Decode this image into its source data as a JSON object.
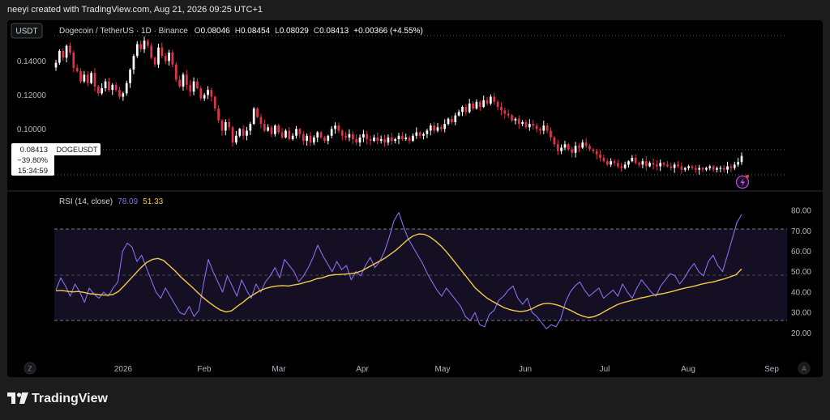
{
  "header": {
    "caption": "neeyi created with TradingView.com, Aug 21, 2026 09:25 UTC+1"
  },
  "main_pane": {
    "currency_button": "USDT",
    "symbol_desc": "Dogecoin / TetherUS · 1D · Binance",
    "ohlc": {
      "o_label": "O",
      "o_value": "0.08046",
      "h_label": "H",
      "h_value": "0.08454",
      "l_label": "L",
      "l_value": "0.08029",
      "c_label": "C",
      "c_value": "0.08413",
      "change": "+0.00366 (+4.55%)"
    },
    "price_tag": {
      "price": "0.08413",
      "change_pct": "−39.80%",
      "countdown": "15:34:59",
      "symbol": "DOGEUSDT"
    },
    "up_color": "#ffffff",
    "down_color": "#e0344c"
  },
  "rsi_pane": {
    "label": "RSI (14, close)",
    "rsi_value": "78.09",
    "ma_value": "51.33",
    "rsi_color": "#8e6cf0",
    "ma_color": "#f2c94c"
  },
  "bottom_buttons": {
    "left": "Z",
    "right": "A"
  },
  "footer": {
    "brand": "TradingView"
  },
  "chart_data": [
    {
      "type": "candlestick",
      "title": "Dogecoin / TetherUS · 1D · Binance",
      "x_ticks": [
        "2026",
        "Feb",
        "Mar",
        "Apr",
        "May",
        "Jun",
        "Jul",
        "Aug",
        "Sep"
      ],
      "y_ticks": [
        "0.14000",
        "0.12000",
        "0.10000"
      ],
      "ylim": [
        0.073,
        0.155
      ],
      "last_price": 0.08413,
      "series_closes": [
        0.139,
        0.146,
        0.142,
        0.149,
        0.145,
        0.136,
        0.134,
        0.128,
        0.132,
        0.127,
        0.133,
        0.125,
        0.121,
        0.124,
        0.128,
        0.123,
        0.126,
        0.123,
        0.119,
        0.121,
        0.127,
        0.135,
        0.143,
        0.15,
        0.147,
        0.152,
        0.149,
        0.142,
        0.138,
        0.148,
        0.143,
        0.14,
        0.145,
        0.138,
        0.129,
        0.125,
        0.132,
        0.126,
        0.122,
        0.128,
        0.124,
        0.118,
        0.12,
        0.123,
        0.119,
        0.112,
        0.105,
        0.099,
        0.104,
        0.101,
        0.092,
        0.096,
        0.1,
        0.096,
        0.099,
        0.103,
        0.112,
        0.107,
        0.103,
        0.099,
        0.101,
        0.097,
        0.102,
        0.098,
        0.095,
        0.099,
        0.094,
        0.096,
        0.1,
        0.097,
        0.093,
        0.096,
        0.092,
        0.095,
        0.098,
        0.095,
        0.093,
        0.096,
        0.1,
        0.102,
        0.099,
        0.096,
        0.095,
        0.097,
        0.094,
        0.092,
        0.095,
        0.097,
        0.094,
        0.093,
        0.095,
        0.093,
        0.094,
        0.092,
        0.095,
        0.093,
        0.094,
        0.096,
        0.094,
        0.095,
        0.093,
        0.096,
        0.098,
        0.096,
        0.097,
        0.099,
        0.102,
        0.099,
        0.101,
        0.1,
        0.103,
        0.106,
        0.104,
        0.108,
        0.11,
        0.113,
        0.11,
        0.115,
        0.112,
        0.116,
        0.113,
        0.117,
        0.115,
        0.119,
        0.116,
        0.113,
        0.111,
        0.109,
        0.108,
        0.105,
        0.106,
        0.103,
        0.104,
        0.101,
        0.103,
        0.102,
        0.1,
        0.099,
        0.102,
        0.099,
        0.095,
        0.091,
        0.087,
        0.089,
        0.091,
        0.088,
        0.086,
        0.09,
        0.089,
        0.092,
        0.09,
        0.088,
        0.087,
        0.085,
        0.083,
        0.081,
        0.079,
        0.081,
        0.08,
        0.078,
        0.077,
        0.079,
        0.081,
        0.083,
        0.08,
        0.079,
        0.081,
        0.078,
        0.08,
        0.079,
        0.078,
        0.08,
        0.079,
        0.078,
        0.077,
        0.079,
        0.078,
        0.076,
        0.077,
        0.078,
        0.077,
        0.076,
        0.077,
        0.076,
        0.077,
        0.078,
        0.076,
        0.077,
        0.077,
        0.076,
        0.078,
        0.077,
        0.079,
        0.0805,
        0.0841
      ]
    },
    {
      "type": "line",
      "title": "RSI (14, close)",
      "y_ticks": [
        "80.00",
        "70.00",
        "60.00",
        "50.00",
        "40.00",
        "30.00",
        "20.00"
      ],
      "ylim": [
        15,
        82
      ],
      "bands": {
        "upper": 70,
        "middle": 50,
        "lower": 30
      },
      "series": [
        {
          "name": "RSI",
          "values": [
            41,
            47,
            43,
            38,
            44,
            40,
            35,
            42,
            39,
            37,
            40,
            38,
            42,
            45,
            60,
            64,
            62,
            55,
            58,
            52,
            46,
            40,
            37,
            42,
            38,
            34,
            30,
            29,
            33,
            28,
            31,
            44,
            56,
            50,
            45,
            40,
            48,
            43,
            38,
            46,
            41,
            37,
            44,
            40,
            45,
            48,
            52,
            47,
            56,
            53,
            50,
            45,
            48,
            52,
            57,
            63,
            58,
            54,
            50,
            55,
            51,
            53,
            46,
            50,
            48,
            53,
            57,
            52,
            55,
            60,
            67,
            75,
            79,
            72,
            66,
            62,
            58,
            54,
            49,
            45,
            41,
            38,
            42,
            39,
            36,
            33,
            28,
            26,
            30,
            24,
            23,
            29,
            31,
            36,
            38,
            41,
            43,
            37,
            34,
            37,
            30,
            28,
            25,
            22,
            24,
            23,
            27,
            35,
            40,
            43,
            45,
            41,
            38,
            40,
            42,
            37,
            39,
            41,
            38,
            44,
            40,
            37,
            42,
            46,
            43,
            40,
            38,
            43,
            46,
            49,
            48,
            44,
            47,
            51,
            54,
            50,
            48,
            55,
            58,
            53,
            50,
            58,
            66,
            74,
            78.09
          ]
        },
        {
          "name": "MA",
          "values": [
            40.6,
            40.8,
            40.4,
            40.1,
            40.3,
            39.8,
            39.2,
            39.0,
            38.6,
            38.5,
            38.8,
            40.2,
            43,
            46,
            49,
            52,
            54.5,
            56,
            56.5,
            55.5,
            53,
            50.5,
            47.5,
            45,
            42.5,
            39.8,
            37.3,
            35,
            33,
            31.2,
            30.3,
            30.8,
            33,
            35,
            37.3,
            39,
            40.7,
            41.8,
            42.5,
            43,
            43.2,
            43,
            43.5,
            44,
            44.8,
            45.5,
            46.5,
            47,
            48,
            48.5,
            48.6,
            48.8,
            49,
            49.5,
            50.5,
            52,
            53.5,
            55,
            56.5,
            58.5,
            60.5,
            63,
            65.5,
            67.5,
            68.5,
            68.3,
            67,
            65,
            62.5,
            59.5,
            56,
            52.5,
            49,
            45.5,
            42,
            39.5,
            37.2,
            35.5,
            34,
            32.5,
            31.5,
            30.8,
            30.5,
            30.8,
            31.8,
            33.3,
            34.3,
            34.5,
            34,
            33.2,
            32,
            30.8,
            29.3,
            28.2,
            27.5,
            28,
            29.2,
            30.8,
            32.3,
            33.8,
            34.8,
            35.5,
            36.2,
            37,
            37.5,
            38.2,
            38.8,
            39.2,
            39.8,
            40.5,
            41.3,
            42,
            42.5,
            43.2,
            44,
            44.5,
            45,
            45.8,
            46.5,
            47.5,
            48.5,
            51.33
          ]
        }
      ]
    }
  ]
}
